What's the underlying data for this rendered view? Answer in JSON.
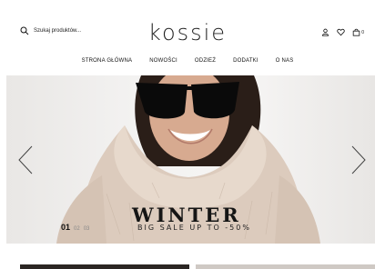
{
  "header": {
    "search_placeholder": "Szukaj produktów...",
    "logo": "kossie",
    "bag_count": "0"
  },
  "nav": {
    "items": [
      "STRONA GŁÓWNA",
      "NOWOŚCI",
      "ODZIEŻ",
      "DODATKI",
      "O NAS"
    ]
  },
  "hero": {
    "title": "WINTER",
    "subtitle": "BIG SALE UP TO -50%",
    "pager": [
      "01",
      "02",
      "03"
    ],
    "active_slide": 0
  },
  "icons": [
    "search-icon",
    "user-icon",
    "heart-icon",
    "bag-icon",
    "chevron-left-icon",
    "chevron-right-icon"
  ]
}
